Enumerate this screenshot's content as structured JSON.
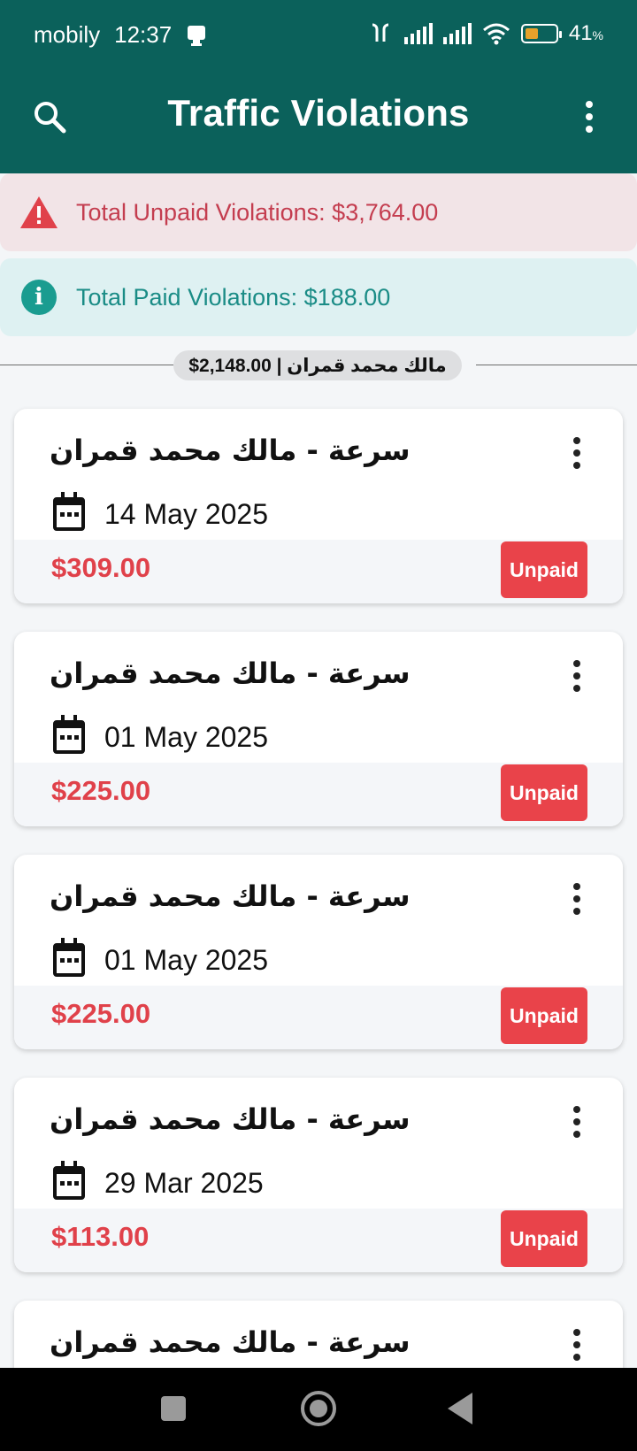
{
  "status_bar": {
    "carrier": "mobily",
    "time": "12:37",
    "battery_percent": "41",
    "battery_unit": "%"
  },
  "app_bar": {
    "title": "Traffic Violations",
    "icons": [
      "search-icon",
      "more-vert-icon"
    ]
  },
  "summary": {
    "unpaid_text": "Total Unpaid Violations: $3,764.00",
    "paid_text": "Total Paid Violations: $188.00",
    "unpaid_icon": "warning-icon",
    "paid_icon": "info-icon"
  },
  "owner_group": {
    "label": "مالك محمد قمران | 2,148.00$"
  },
  "violations": [
    {
      "title": "سرعة - مالك محمد قمران",
      "date": "14 May 2025",
      "amount": "$309.00",
      "status": "Unpaid"
    },
    {
      "title": "سرعة - مالك محمد قمران",
      "date": "01 May 2025",
      "amount": "$225.00",
      "status": "Unpaid"
    },
    {
      "title": "سرعة - مالك محمد قمران",
      "date": "01 May 2025",
      "amount": "$225.00",
      "status": "Unpaid"
    },
    {
      "title": "سرعة - مالك محمد قمران",
      "date": "29 Mar 2025",
      "amount": "$113.00",
      "status": "Unpaid"
    },
    {
      "title": "سرعة - مالك محمد قمران"
    }
  ],
  "colors": {
    "app_bar": "#0b615b",
    "unpaid_accent": "#e9434a",
    "paid_accent": "#1a9c90"
  }
}
